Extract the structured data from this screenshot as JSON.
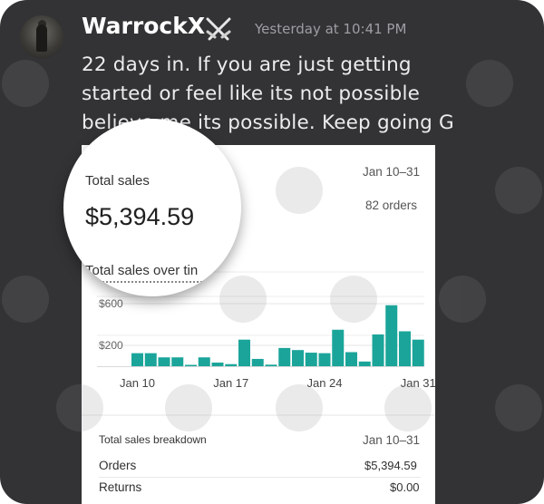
{
  "post": {
    "username": "WarrockX",
    "badge_icon": "crossed-swords-icon",
    "timestamp": "Yesterday at 10:41 PM",
    "message_lines": [
      "22 days in. If you are just getting",
      "started or feel like its not possible",
      "believe me its possible. Keep going G"
    ]
  },
  "screenshot": {
    "date_range": "Jan 10–31",
    "orders_summary": "82 orders",
    "total_sales_label": "Total sales",
    "total_sales_value": "$5,394.59",
    "over_time_title": "Total sales over tin",
    "breakdown_title": "Total sales breakdown",
    "breakdown_range": "Jan 10–31",
    "breakdown_rows": [
      {
        "label": "Orders",
        "value": "$5,394.59"
      },
      {
        "label": "Returns",
        "value": "$0.00"
      }
    ]
  },
  "chart_data": {
    "type": "bar",
    "title": "Total sales over time",
    "color": "#1ba59a",
    "ylim": [
      0,
      1050
    ],
    "yticks": [
      {
        "value": 200,
        "label": "$200"
      },
      {
        "value": 600,
        "label": "$600"
      }
    ],
    "x_ticks": [
      {
        "index": 0,
        "label": "Jan 10"
      },
      {
        "index": 7,
        "label": "Jan 17"
      },
      {
        "index": 14,
        "label": "Jan 24"
      },
      {
        "index": 21,
        "label": "Jan 31"
      }
    ],
    "categories": [
      "Jan 10",
      "Jan 11",
      "Jan 12",
      "Jan 13",
      "Jan 14",
      "Jan 15",
      "Jan 16",
      "Jan 17",
      "Jan 18",
      "Jan 19",
      "Jan 20",
      "Jan 21",
      "Jan 22",
      "Jan 23",
      "Jan 24",
      "Jan 25",
      "Jan 26",
      "Jan 27",
      "Jan 28",
      "Jan 29",
      "Jan 30",
      "Jan 31"
    ],
    "values": [
      125,
      125,
      85,
      85,
      10,
      85,
      35,
      20,
      255,
      70,
      15,
      175,
      155,
      130,
      125,
      350,
      135,
      45,
      305,
      585,
      335,
      255
    ],
    "grid": true
  },
  "colors": {
    "card_bg": "#333335",
    "username": "#ffffff",
    "timestamp": "#9d9ea3",
    "message": "#ececee",
    "bar": "#1ba59a"
  }
}
